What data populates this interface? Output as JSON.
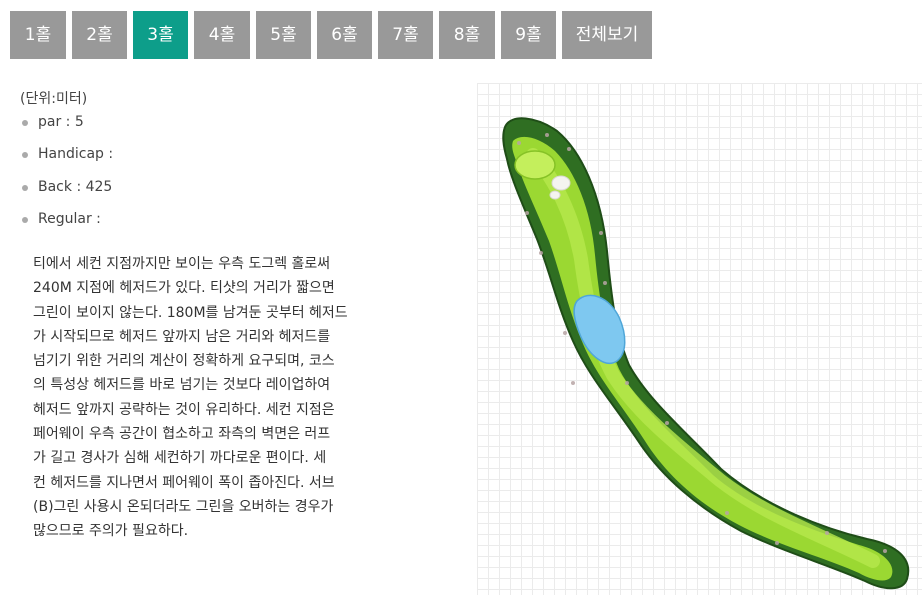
{
  "tabs": [
    {
      "label": "1홀",
      "active": false
    },
    {
      "label": "2홀",
      "active": false
    },
    {
      "label": "3홀",
      "active": true
    },
    {
      "label": "4홀",
      "active": false
    },
    {
      "label": "5홀",
      "active": false
    },
    {
      "label": "6홀",
      "active": false
    },
    {
      "label": "7홀",
      "active": false
    },
    {
      "label": "8홀",
      "active": false
    },
    {
      "label": "9홀",
      "active": false
    },
    {
      "label": "전체보기",
      "active": false
    }
  ],
  "unit_note": "(단위:미터)",
  "info": {
    "par": "par : 5",
    "handicap": "Handicap :",
    "back": "Back : 425",
    "regular": "Regular :"
  },
  "description_lines": [
    "티에서 세컨 지점까지만 보이는 우측 도그렉 홀로써",
    "240M 지점에 헤저드가 있다. 티샷의 거리가 짧으면",
    "그린이 보이지 않는다. 180M를 남겨둔 곳부터 헤저드",
    "가 시작되므로 헤저드 앞까지 남은 거리와 헤저드를",
    "넘기기 위한 거리의 계산이 정확하게 요구되며, 코스",
    "의 특성상 헤저드를 바로 넘기는 것보다 레이업하여",
    "헤저드 앞까지 공략하는 것이 유리하다. 세컨 지점은",
    "페어웨이 우측 공간이 협소하고 좌측의 벽면은 러프",
    "가 길고 경사가 심해 세컨하기 까다로운 편이다. 세",
    "컨 헤저드를 지나면서 페어웨이 폭이 좁아진다. 서브",
    "(B)그린 사용시 온되더라도 그린을 오버하는 경우가",
    "많으므로 주의가 필요하다."
  ],
  "colors": {
    "tab_bg": "#999999",
    "tab_active_bg": "#0d9e8a",
    "fairway": "#9bd832",
    "rough": "#2f6e22",
    "hazard": "#7ec8f0"
  },
  "icons": {
    "bullet": "gray-dot",
    "map": "hole-layout-map"
  }
}
